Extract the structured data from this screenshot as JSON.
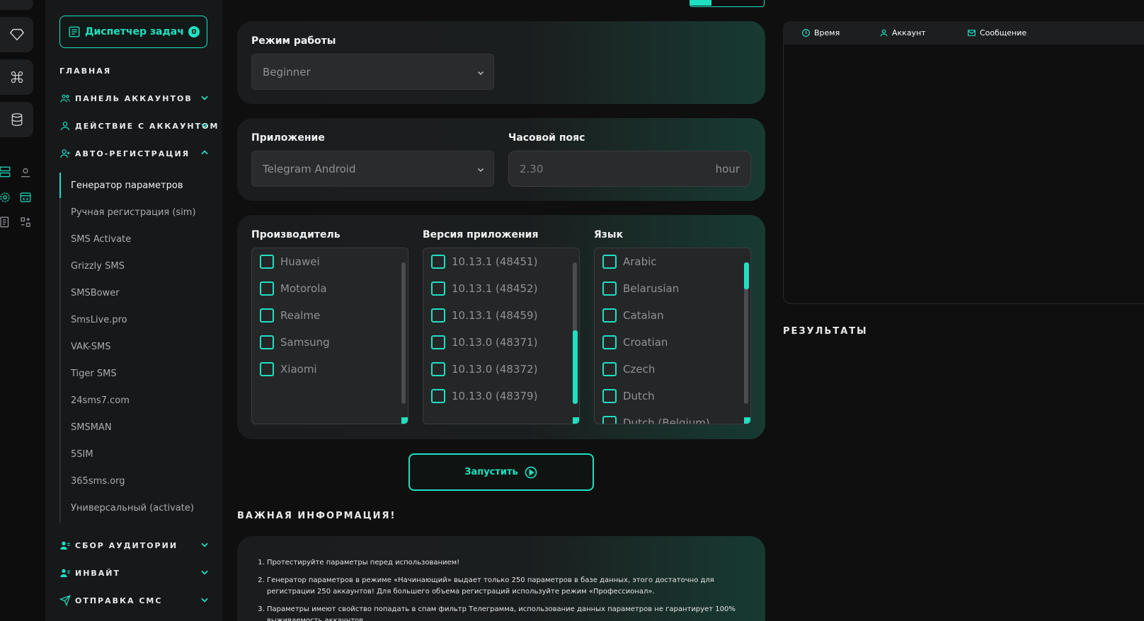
{
  "sidebar": {
    "task_manager": {
      "label": "Диспетчер задач",
      "count": "0"
    },
    "main_label": "ГЛАВНАЯ",
    "sections": [
      {
        "label": "ПАНЕЛЬ АККАУНТОВ",
        "icon": "users-icon",
        "expanded": false
      },
      {
        "label": "ДЕЙСТВИЕ С АККАУНТОМ",
        "icon": "user-icon",
        "expanded": false
      },
      {
        "label": "АВТО-РЕГИСТРАЦИЯ",
        "icon": "user-plus-icon",
        "expanded": true
      }
    ],
    "auto_reg_items": [
      "Генератор параметров",
      "Ручная регистрация (sim)",
      "SMS Activate",
      "Grizzly SMS",
      "SMSBower",
      "SmsLive.pro",
      "VAK-SMS",
      "Tiger SMS",
      "24sms7.com",
      "SMSMAN",
      "5SIM",
      "365sms.org",
      "Универсальный (activate)"
    ],
    "lower_sections": [
      {
        "label": "СБОР АУДИТОРИИ",
        "icon": "audience-icon"
      },
      {
        "label": "ИНВАЙТ",
        "icon": "invite-icon"
      },
      {
        "label": "ОТПРАВКА СМС",
        "icon": "send-icon"
      }
    ]
  },
  "mode": {
    "label": "Режим работы",
    "value": "Beginner"
  },
  "app": {
    "label": "Приложение",
    "value": "Telegram Android"
  },
  "timezone": {
    "label": "Часовой пояс",
    "value": "2.30",
    "unit": "hour"
  },
  "manufacturer": {
    "label": "Производитель",
    "options": [
      "Huawei",
      "Motorola",
      "Realme",
      "Samsung",
      "Xiaomi"
    ]
  },
  "app_version": {
    "label": "Версия приложения",
    "options": [
      "10.13.1 (48451)",
      "10.13.1 (48452)",
      "10.13.1 (48459)",
      "10.13.0 (48371)",
      "10.13.0 (48372)",
      "10.13.0 (48379)"
    ]
  },
  "language": {
    "label": "Язык",
    "options": [
      "Arabic",
      "Belarusian",
      "Catalan",
      "Croatian",
      "Czech",
      "Dutch",
      "Dutch (Belgium)"
    ]
  },
  "run_button": {
    "label": "Запустить"
  },
  "info": {
    "title": "ВАЖНАЯ ИНФОРМАЦИЯ!",
    "items": [
      "Протестируйте параметры перед использованием!",
      "Генератор параметров в режиме «Начинающий» выдает только 250 параметров в базе данных, этого достаточно для регистрации 250 аккаунтов! Для большего объема регистраций используйте режим «Профессионал».",
      "Параметры имеют свойство попадать в спам фильтр Телеграмма, использование данных параметров не гарантирует 100% выживаемость аккаунтов."
    ]
  },
  "right_panel": {
    "tabs": [
      {
        "label": "Время",
        "icon": "clock-icon"
      },
      {
        "label": "Аккаунт",
        "icon": "user-icon"
      },
      {
        "label": "Сообщение",
        "icon": "mail-icon"
      }
    ],
    "results_label": "РЕЗУЛЬТАТЫ"
  },
  "colors": {
    "accent": "#1fe0c0",
    "background": "#0f0f10",
    "panel": "#17181a"
  }
}
